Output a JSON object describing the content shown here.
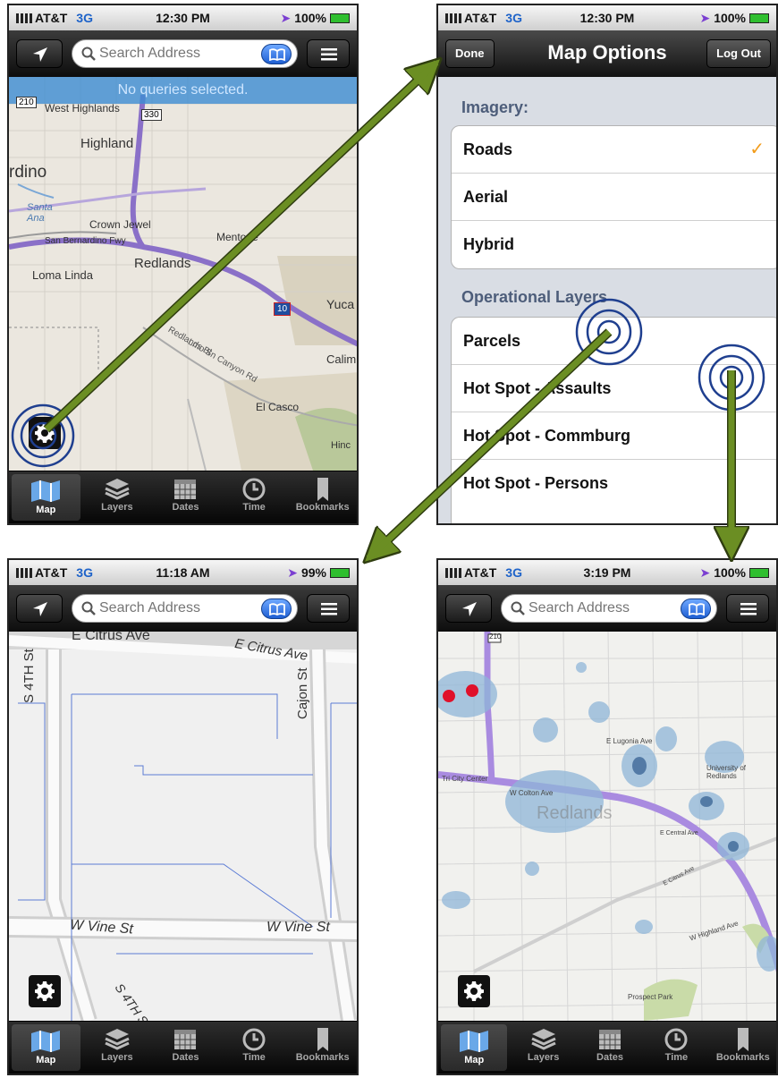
{
  "status": {
    "p1": {
      "carrier": "AT&T",
      "net": "3G",
      "time": "12:30 PM",
      "battery": "100%"
    },
    "p2": {
      "carrier": "AT&T",
      "net": "3G",
      "time": "12:30 PM",
      "battery": "100%"
    },
    "p3": {
      "carrier": "AT&T",
      "net": "3G",
      "time": "11:18 AM",
      "battery": "99%"
    },
    "p4": {
      "carrier": "AT&T",
      "net": "3G",
      "time": "3:19 PM",
      "battery": "100%"
    }
  },
  "search": {
    "placeholder": "Search Address"
  },
  "map1": {
    "banner": "No queries selected.",
    "labels": [
      "West Highlands",
      "Highland",
      "rdino",
      "Santa Ana",
      "Crown Jewel",
      "San Bernardino Fwy",
      "Mentone",
      "Redlands",
      "Loma Linda",
      "Yuca",
      "Calim",
      "Redlands Bl",
      "Lmo Sn Canyon Rd",
      "El Casco",
      "Hinc"
    ],
    "shields": [
      "210",
      "330",
      "10"
    ]
  },
  "map3": {
    "labels": [
      "E Citrus Ave",
      "E Citrus Ave",
      "S 4TH St",
      "Cajon St",
      "W Vine St",
      "W Vine St",
      "S 4TH St"
    ]
  },
  "map4": {
    "labels": [
      "Redlands",
      "University of Redlands",
      "Tri City Center",
      "W Colton Ave",
      "E Lugonia Ave",
      "Prospect Park",
      "W Highland Ave",
      "E Central Ave",
      "E Citrus Ave"
    ],
    "shield": "210"
  },
  "options": {
    "done": "Done",
    "title": "Map Options",
    "logout": "Log Out",
    "imagery_header": "Imagery:",
    "imagery": [
      {
        "label": "Roads",
        "checked": true,
        "mark": "✓"
      },
      {
        "label": "Aerial",
        "checked": false
      },
      {
        "label": "Hybrid",
        "checked": false
      }
    ],
    "layers_header": "Operational Layers",
    "layers": [
      "Parcels",
      "Hot Spot - Assaults",
      "Hot Spot - Commburg",
      "Hot Spot - Persons"
    ]
  },
  "tabs": [
    "Map",
    "Layers",
    "Dates",
    "Time",
    "Bookmarks"
  ],
  "colors": {
    "arrow": "#6b8e23",
    "ring": "#1f3f8f",
    "accent": "#1e63c9",
    "check": "#f29c1b",
    "heat_red": "#e0102a",
    "heat_blue": "#9fc3e0"
  }
}
